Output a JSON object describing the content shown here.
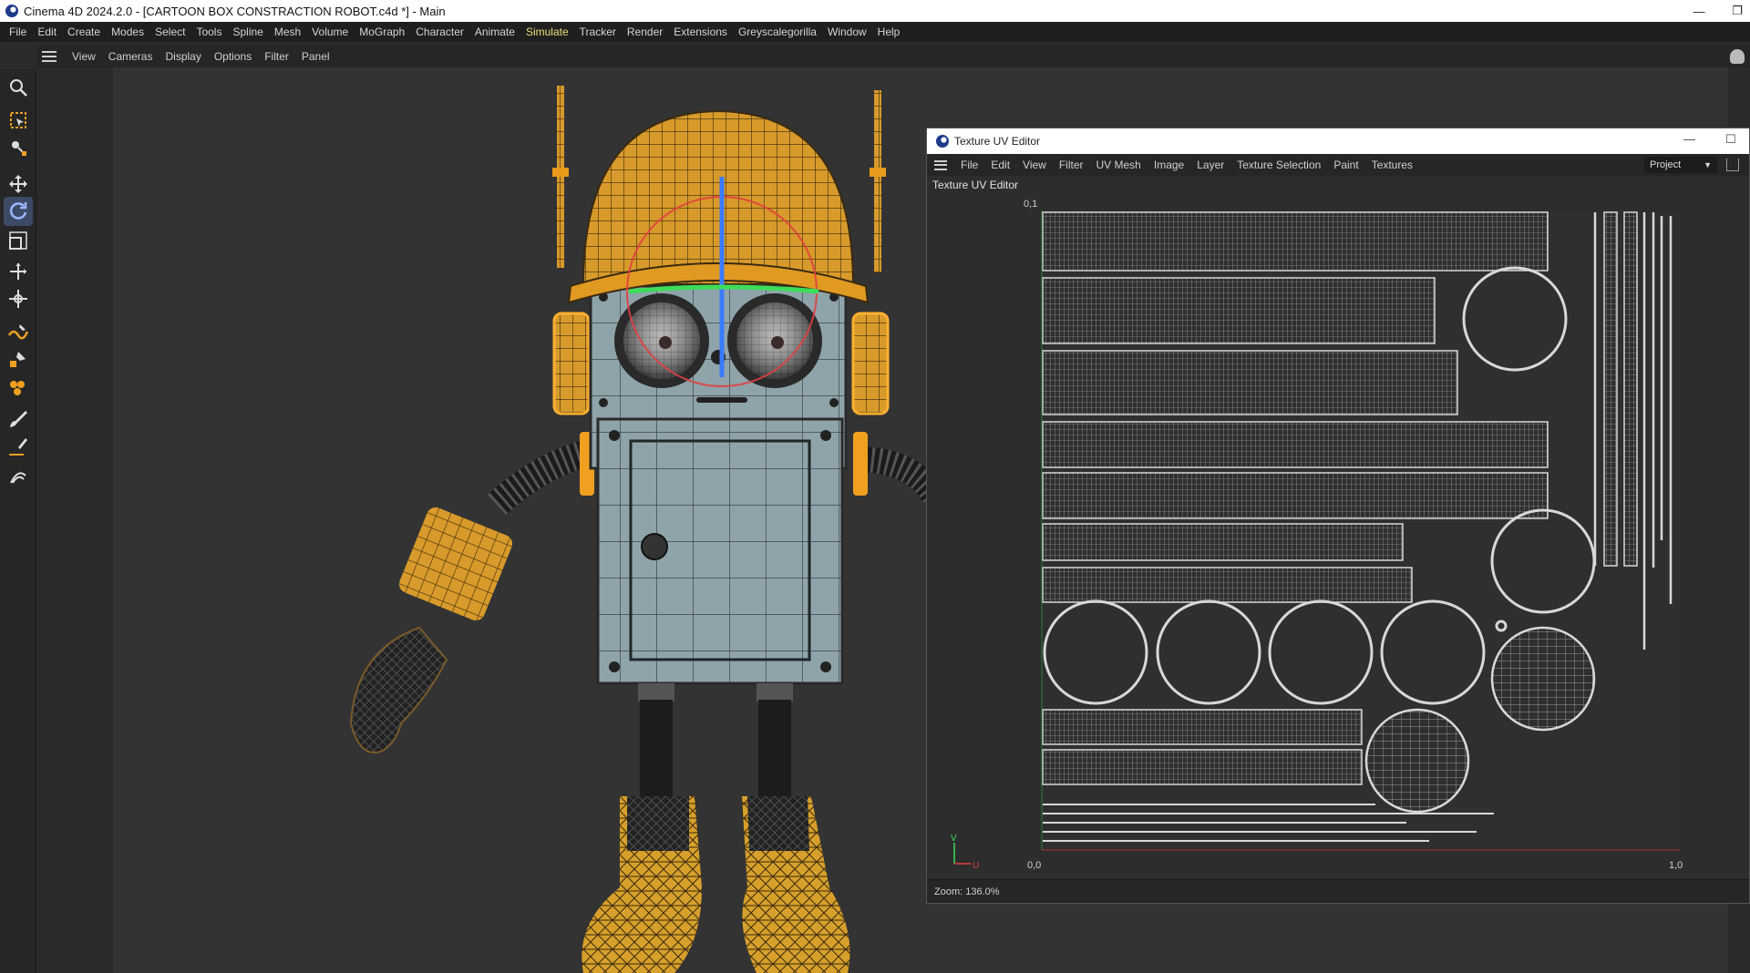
{
  "window": {
    "title": "Cinema 4D 2024.2.0 - [CARTOON BOX CONSTRACTION ROBOT.c4d *] - Main",
    "minimize_glyph": "—",
    "restore_glyph": "❐"
  },
  "main_menu": [
    {
      "label": "File"
    },
    {
      "label": "Edit"
    },
    {
      "label": "Create"
    },
    {
      "label": "Modes"
    },
    {
      "label": "Select"
    },
    {
      "label": "Tools"
    },
    {
      "label": "Spline"
    },
    {
      "label": "Mesh"
    },
    {
      "label": "Volume"
    },
    {
      "label": "MoGraph"
    },
    {
      "label": "Character"
    },
    {
      "label": "Animate"
    },
    {
      "label": "Simulate"
    },
    {
      "label": "Tracker"
    },
    {
      "label": "Render"
    },
    {
      "label": "Extensions"
    },
    {
      "label": "Greyscalegorilla"
    },
    {
      "label": "Window"
    },
    {
      "label": "Help"
    }
  ],
  "main_menu_highlight_color": "#e7e07a",
  "viewport_menu": [
    {
      "label": "View"
    },
    {
      "label": "Cameras"
    },
    {
      "label": "Display"
    },
    {
      "label": "Options"
    },
    {
      "label": "Filter"
    },
    {
      "label": "Panel"
    }
  ],
  "tools": [
    {
      "icon": "search-icon"
    },
    {
      "icon": "live-selection-icon"
    },
    {
      "icon": "tweak-icon"
    },
    {
      "icon": "move-icon"
    },
    {
      "icon": "rotate-icon",
      "active": true
    },
    {
      "icon": "scale-icon"
    },
    {
      "icon": "transfer-icon"
    },
    {
      "icon": "placement-icon"
    },
    {
      "icon": "spline-pen-icon"
    },
    {
      "icon": "spline-sketch-icon"
    },
    {
      "icon": "polygon-pen-icon"
    },
    {
      "icon": "brush-icon"
    },
    {
      "icon": "knife-icon"
    },
    {
      "icon": "hair-icon"
    }
  ],
  "colors": {
    "accent_orange": "#f0a020",
    "wire_orange": "#e89a1a",
    "active_tool": "#3d4a66",
    "axis_blue": "#3a7bff",
    "axis_green": "#3ddc5a",
    "axis_red": "#e04040"
  },
  "uv_editor": {
    "title": "Texture UV Editor",
    "minimize_glyph": "—",
    "maximize_glyph": "☐",
    "menu": [
      {
        "label": "File"
      },
      {
        "label": "Edit"
      },
      {
        "label": "View"
      },
      {
        "label": "Filter"
      },
      {
        "label": "UV Mesh"
      },
      {
        "label": "Image"
      },
      {
        "label": "Layer"
      },
      {
        "label": "Texture Selection"
      },
      {
        "label": "Paint"
      },
      {
        "label": "Textures"
      }
    ],
    "project_dropdown": "Project",
    "panel_title": "Texture UV Editor",
    "axis": {
      "top_left": "0,1",
      "origin": "0,0",
      "right": "1,0",
      "v_label": "V",
      "u_label": "U"
    },
    "zoom_label": "Zoom: 136.0%"
  }
}
